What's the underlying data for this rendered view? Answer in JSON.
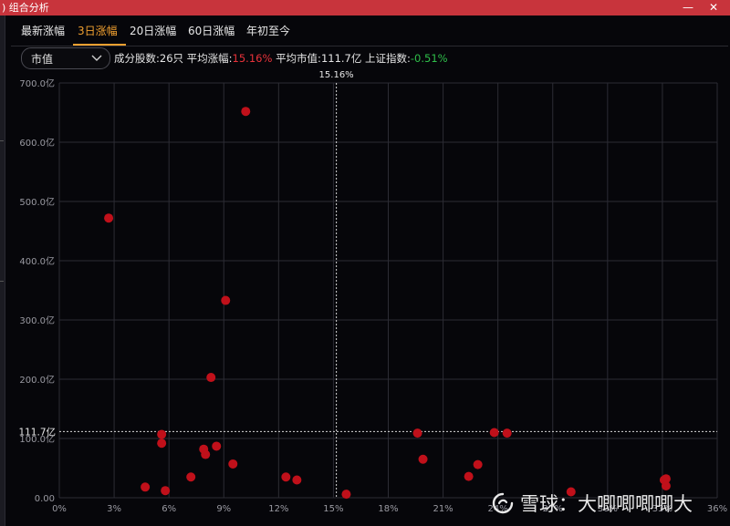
{
  "window": {
    "title": ") 组合分析",
    "minimize": "—",
    "close": "✕"
  },
  "tabs": [
    {
      "label": "最新涨幅",
      "active": false
    },
    {
      "label": "3日涨幅",
      "active": true
    },
    {
      "label": "20日涨幅",
      "active": false
    },
    {
      "label": "60日涨幅",
      "active": false
    },
    {
      "label": "年初至今",
      "active": false
    }
  ],
  "dropdown": {
    "value": "市值",
    "icon": "chevron-down-icon"
  },
  "stats": {
    "components_label": "成分股数:",
    "components_value": "26只",
    "avg_gain_label": "平均涨幅:",
    "avg_gain_value": "15.16%",
    "avg_cap_label": "平均市值:",
    "avg_cap_value": "111.7亿",
    "index_label": "上证指数:",
    "index_value": "-0.51%"
  },
  "colors": {
    "accent": "#f0a030",
    "up": "#e8323a",
    "down": "#2fbf4a",
    "point": "#c0101a",
    "titlebar": "#c8343c"
  },
  "watermark": {
    "text": "雪球：大唧唧唧唧大",
    "icon": "xueqiu-logo-icon"
  },
  "chart_data": {
    "type": "scatter",
    "xlabel": "",
    "ylabel": "",
    "xlim": [
      0,
      36
    ],
    "ylim": [
      0,
      700
    ],
    "x_ticks": [
      0,
      3,
      6,
      9,
      12,
      15,
      18,
      21,
      24,
      27,
      30,
      33,
      36
    ],
    "x_tick_labels": [
      "0%",
      "3%",
      "6%",
      "9%",
      "12%",
      "15%",
      "18%",
      "21%",
      "24%",
      "27%",
      "30%",
      "33%",
      "36%"
    ],
    "y_ticks": [
      0,
      100,
      200,
      300,
      400,
      500,
      600,
      700
    ],
    "y_tick_labels": [
      "0.00",
      "100.0亿",
      "200.0亿",
      "300.0亿",
      "400.0亿",
      "500.0亿",
      "600.0亿",
      "700.0亿"
    ],
    "grid": true,
    "ref_x": {
      "value": 15.16,
      "label": "15.16%"
    },
    "ref_y": {
      "value": 111.7,
      "label": "111.7亿"
    },
    "points": [
      {
        "x": 2.7,
        "y": 472
      },
      {
        "x": 10.2,
        "y": 652
      },
      {
        "x": 9.1,
        "y": 333
      },
      {
        "x": 8.3,
        "y": 203
      },
      {
        "x": 5.6,
        "y": 107
      },
      {
        "x": 5.6,
        "y": 92
      },
      {
        "x": 7.9,
        "y": 82
      },
      {
        "x": 8.0,
        "y": 73
      },
      {
        "x": 8.6,
        "y": 87
      },
      {
        "x": 9.5,
        "y": 57
      },
      {
        "x": 7.2,
        "y": 35
      },
      {
        "x": 4.7,
        "y": 18
      },
      {
        "x": 5.8,
        "y": 12
      },
      {
        "x": 12.4,
        "y": 35
      },
      {
        "x": 13.0,
        "y": 30
      },
      {
        "x": 15.7,
        "y": 6
      },
      {
        "x": 19.6,
        "y": 109
      },
      {
        "x": 19.9,
        "y": 65
      },
      {
        "x": 22.4,
        "y": 36
      },
      {
        "x": 22.9,
        "y": 56
      },
      {
        "x": 23.8,
        "y": 110
      },
      {
        "x": 24.5,
        "y": 109
      },
      {
        "x": 28.0,
        "y": 10
      },
      {
        "x": 33.1,
        "y": 30
      },
      {
        "x": 33.2,
        "y": 32
      },
      {
        "x": 33.2,
        "y": 20
      }
    ]
  }
}
